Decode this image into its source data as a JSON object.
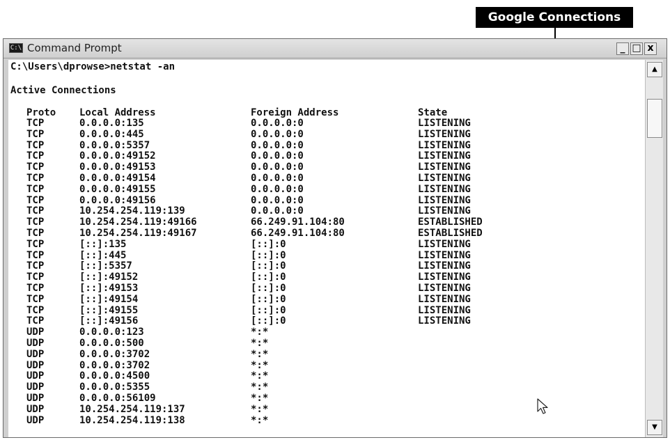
{
  "callout": {
    "label": "Google Connections"
  },
  "window": {
    "title": "Command Prompt",
    "icon_text": "C:\\",
    "buttons": {
      "minimize": "_",
      "maximize": "□",
      "close": "x"
    }
  },
  "console": {
    "command_line": "C:\\Users\\dprowse>netstat -an",
    "heading": "Active Connections",
    "columns": [
      "Proto",
      "Local Address",
      "Foreign Address",
      "State"
    ],
    "rows": [
      [
        "TCP",
        "0.0.0.0:135",
        "0.0.0.0:0",
        "LISTENING"
      ],
      [
        "TCP",
        "0.0.0.0:445",
        "0.0.0.0:0",
        "LISTENING"
      ],
      [
        "TCP",
        "0.0.0.0:5357",
        "0.0.0.0:0",
        "LISTENING"
      ],
      [
        "TCP",
        "0.0.0.0:49152",
        "0.0.0.0:0",
        "LISTENING"
      ],
      [
        "TCP",
        "0.0.0.0:49153",
        "0.0.0.0:0",
        "LISTENING"
      ],
      [
        "TCP",
        "0.0.0.0:49154",
        "0.0.0.0:0",
        "LISTENING"
      ],
      [
        "TCP",
        "0.0.0.0:49155",
        "0.0.0.0:0",
        "LISTENING"
      ],
      [
        "TCP",
        "0.0.0.0:49156",
        "0.0.0.0:0",
        "LISTENING"
      ],
      [
        "TCP",
        "10.254.254.119:139",
        "0.0.0.0:0",
        "LISTENING"
      ],
      [
        "TCP",
        "10.254.254.119:49166",
        "66.249.91.104:80",
        "ESTABLISHED"
      ],
      [
        "TCP",
        "10.254.254.119:49167",
        "66.249.91.104:80",
        "ESTABLISHED"
      ],
      [
        "TCP",
        "[::]:135",
        "[::]:0",
        "LISTENING"
      ],
      [
        "TCP",
        "[::]:445",
        "[::]:0",
        "LISTENING"
      ],
      [
        "TCP",
        "[::]:5357",
        "[::]:0",
        "LISTENING"
      ],
      [
        "TCP",
        "[::]:49152",
        "[::]:0",
        "LISTENING"
      ],
      [
        "TCP",
        "[::]:49153",
        "[::]:0",
        "LISTENING"
      ],
      [
        "TCP",
        "[::]:49154",
        "[::]:0",
        "LISTENING"
      ],
      [
        "TCP",
        "[::]:49155",
        "[::]:0",
        "LISTENING"
      ],
      [
        "TCP",
        "[::]:49156",
        "[::]:0",
        "LISTENING"
      ],
      [
        "UDP",
        "0.0.0.0:123",
        "*:*",
        ""
      ],
      [
        "UDP",
        "0.0.0.0:500",
        "*:*",
        ""
      ],
      [
        "UDP",
        "0.0.0.0:3702",
        "*:*",
        ""
      ],
      [
        "UDP",
        "0.0.0.0:3702",
        "*:*",
        ""
      ],
      [
        "UDP",
        "0.0.0.0:4500",
        "*:*",
        ""
      ],
      [
        "UDP",
        "0.0.0.0:5355",
        "*:*",
        ""
      ],
      [
        "UDP",
        "0.0.0.0:56109",
        "*:*",
        ""
      ],
      [
        "UDP",
        "10.254.254.119:137",
        "*:*",
        ""
      ],
      [
        "UDP",
        "10.254.254.119:138",
        "*:*",
        ""
      ]
    ]
  },
  "icons": {
    "scroll_up": "triangle-up-icon",
    "scroll_down": "triangle-down-icon",
    "cursor": "mouse-pointer-icon"
  }
}
